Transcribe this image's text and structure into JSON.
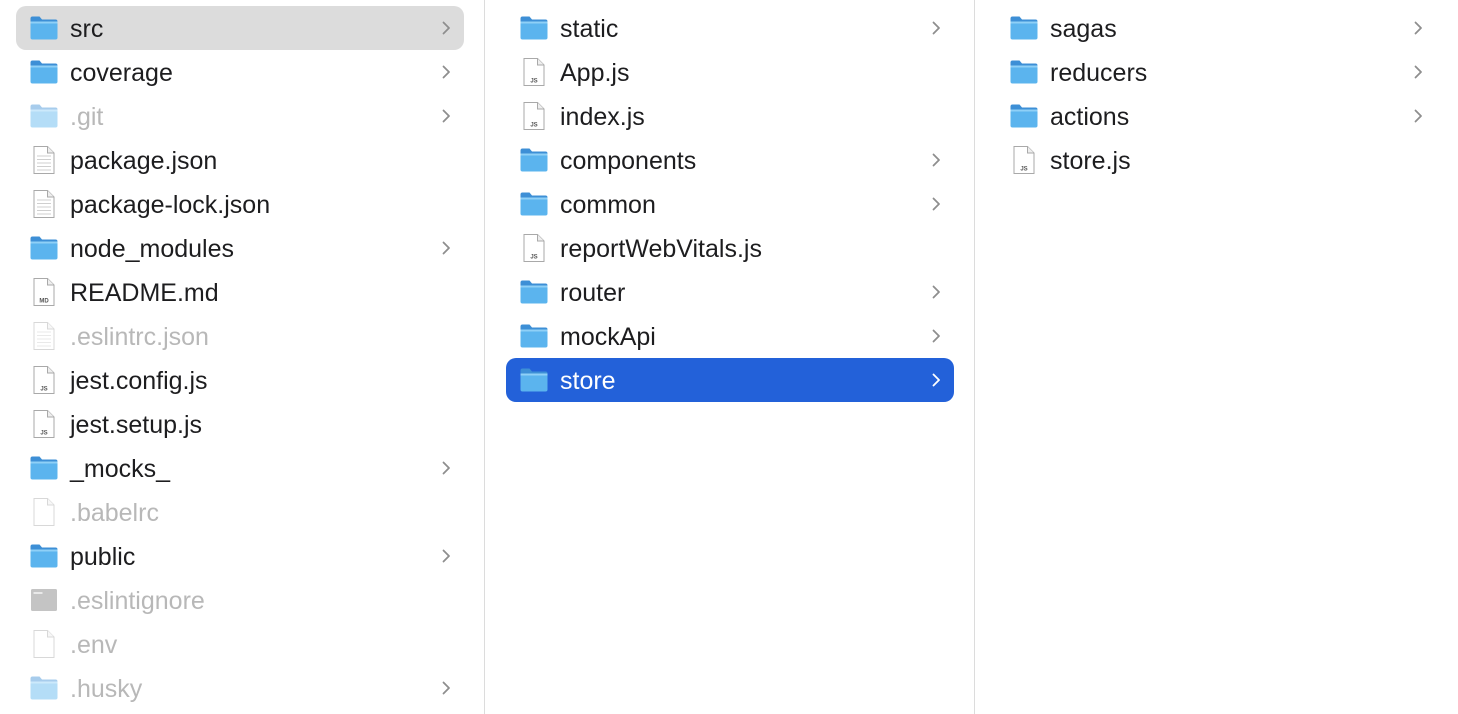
{
  "colors": {
    "folder_blue": "#5bb4ee",
    "selection_gray": "#dcdcdc",
    "selection_blue": "#2361d9",
    "dim_text": "#b8b8b8"
  },
  "columns": [
    {
      "items": [
        {
          "name": "src",
          "kind": "folder",
          "icon": "folder-icon",
          "has_children": true,
          "selected": "gray",
          "dim": false
        },
        {
          "name": "coverage",
          "kind": "folder",
          "icon": "folder-icon",
          "has_children": true,
          "dim": false
        },
        {
          "name": ".git",
          "kind": "folder",
          "icon": "folder-icon",
          "has_children": true,
          "dim": true
        },
        {
          "name": "package.json",
          "kind": "file",
          "icon": "json-file-icon",
          "badge": "",
          "dim": false
        },
        {
          "name": "package-lock.json",
          "kind": "file",
          "icon": "json-file-icon",
          "badge": "",
          "dim": false
        },
        {
          "name": "node_modules",
          "kind": "folder",
          "icon": "folder-icon",
          "has_children": true,
          "dim": false
        },
        {
          "name": "README.md",
          "kind": "file",
          "icon": "markdown-file-icon",
          "badge": "MD",
          "dim": false
        },
        {
          "name": ".eslintrc.json",
          "kind": "file",
          "icon": "json-file-icon",
          "badge": "",
          "dim": true
        },
        {
          "name": "jest.config.js",
          "kind": "file",
          "icon": "js-file-icon",
          "badge": "JS",
          "dim": false
        },
        {
          "name": "jest.setup.js",
          "kind": "file",
          "icon": "js-file-icon",
          "badge": "JS",
          "dim": false
        },
        {
          "name": "_mocks_",
          "kind": "folder",
          "icon": "folder-icon",
          "has_children": true,
          "dim": false
        },
        {
          "name": ".babelrc",
          "kind": "file",
          "icon": "blank-file-icon",
          "badge": "",
          "dim": true
        },
        {
          "name": "public",
          "kind": "folder",
          "icon": "folder-icon",
          "has_children": true,
          "dim": false
        },
        {
          "name": ".eslintignore",
          "kind": "file",
          "icon": "terminal-file-icon",
          "badge": "",
          "dim": true
        },
        {
          "name": ".env",
          "kind": "file",
          "icon": "blank-file-icon",
          "badge": "",
          "dim": true
        },
        {
          "name": ".husky",
          "kind": "folder",
          "icon": "folder-icon",
          "has_children": true,
          "dim": true
        }
      ]
    },
    {
      "items": [
        {
          "name": "static",
          "kind": "folder",
          "icon": "folder-icon",
          "has_children": true,
          "dim": false
        },
        {
          "name": "App.js",
          "kind": "file",
          "icon": "js-file-icon",
          "badge": "JS",
          "dim": false
        },
        {
          "name": "index.js",
          "kind": "file",
          "icon": "js-file-icon",
          "badge": "JS",
          "dim": false
        },
        {
          "name": "components",
          "kind": "folder",
          "icon": "folder-icon",
          "has_children": true,
          "dim": false
        },
        {
          "name": "common",
          "kind": "folder",
          "icon": "folder-icon",
          "has_children": true,
          "dim": false
        },
        {
          "name": "reportWebVitals.js",
          "kind": "file",
          "icon": "js-file-icon",
          "badge": "JS",
          "dim": false
        },
        {
          "name": "router",
          "kind": "folder",
          "icon": "folder-icon",
          "has_children": true,
          "dim": false
        },
        {
          "name": "mockApi",
          "kind": "folder",
          "icon": "folder-icon",
          "has_children": true,
          "dim": false
        },
        {
          "name": "store",
          "kind": "folder",
          "icon": "folder-icon",
          "has_children": true,
          "selected": "blue",
          "dim": false
        }
      ]
    },
    {
      "items": [
        {
          "name": "sagas",
          "kind": "folder",
          "icon": "folder-icon",
          "has_children": true,
          "dim": false
        },
        {
          "name": "reducers",
          "kind": "folder",
          "icon": "folder-icon",
          "has_children": true,
          "dim": false
        },
        {
          "name": "actions",
          "kind": "folder",
          "icon": "folder-icon",
          "has_children": true,
          "dim": false
        },
        {
          "name": "store.js",
          "kind": "file",
          "icon": "js-file-icon",
          "badge": "JS",
          "dim": false
        }
      ]
    }
  ]
}
